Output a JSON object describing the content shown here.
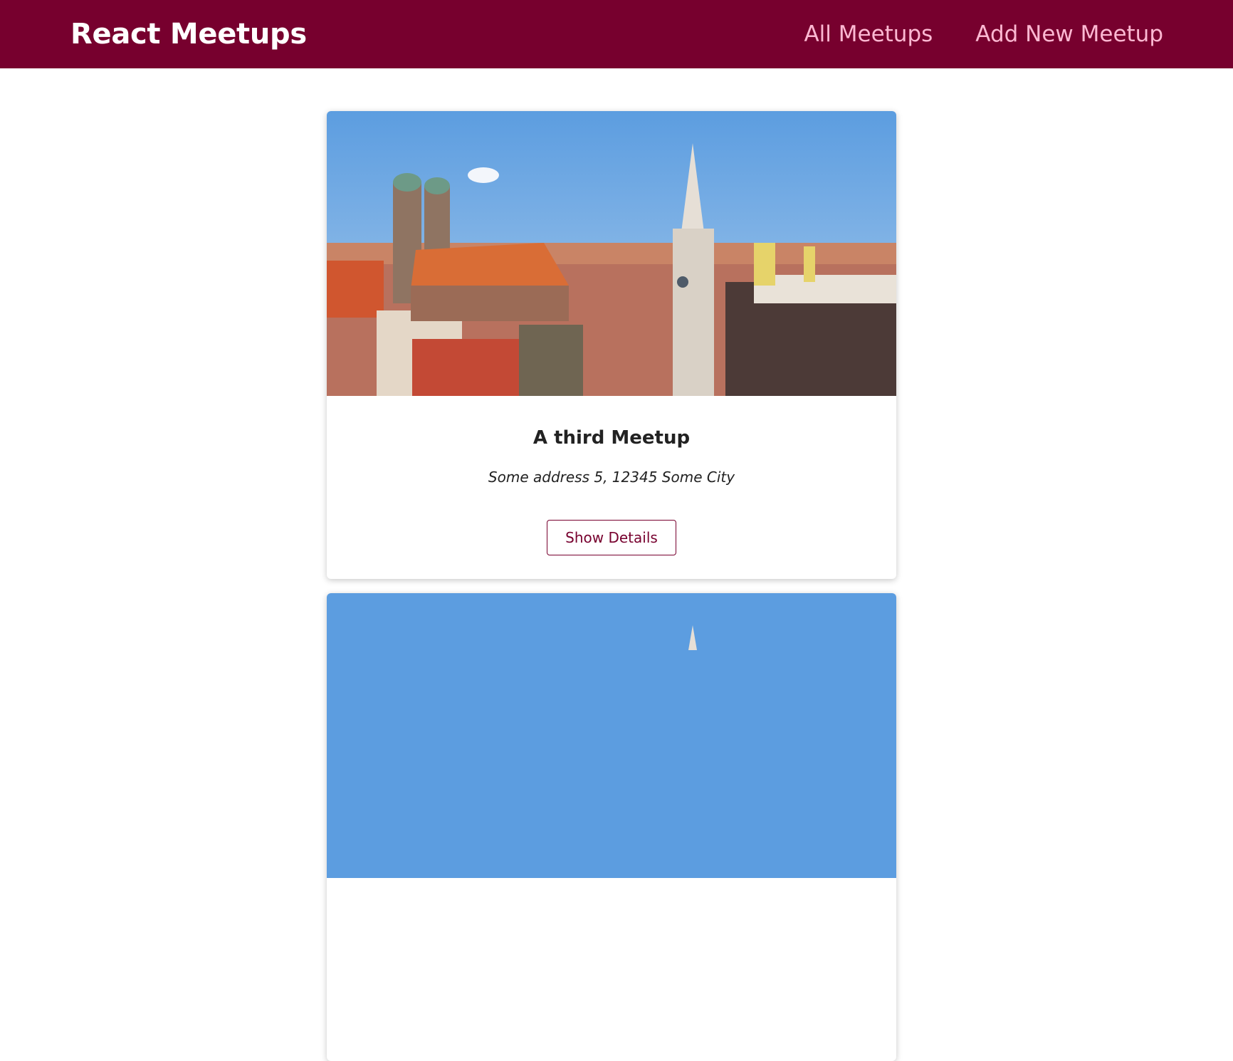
{
  "header": {
    "title": "React Meetups",
    "nav": [
      {
        "label": "All Meetups"
      },
      {
        "label": "Add New Meetup"
      }
    ]
  },
  "meetups": [
    {
      "image": "munich-city-skyline-photo",
      "title": "A third Meetup",
      "address": "Some address 5, 12345 Some City",
      "button_label": "Show Details"
    },
    {
      "image": "munich-city-skyline-photo"
    }
  ],
  "colors": {
    "header_bg": "#77002e",
    "nav_link": "#fcb8d2",
    "accent": "#77002e"
  }
}
